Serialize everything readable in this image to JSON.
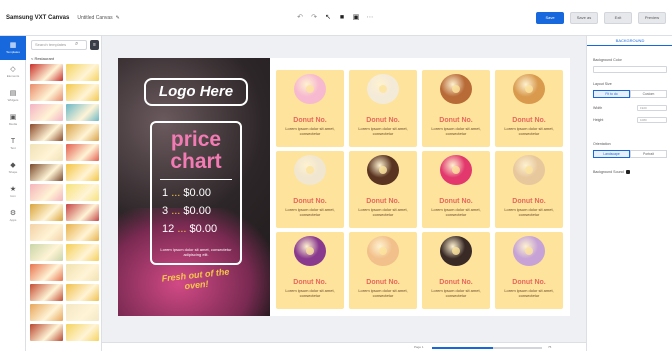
{
  "topbar": {
    "brand": "Samsung VXT Canvas",
    "document_name": "Untitled Canvas",
    "buttons": [
      {
        "label": "Save",
        "primary": true
      },
      {
        "label": "Save as",
        "primary": false
      },
      {
        "label": "Exit",
        "primary": false
      },
      {
        "label": "Preview",
        "primary": false
      }
    ]
  },
  "rail": {
    "items": [
      {
        "label": "Templates",
        "icon": "grid-icon",
        "glyph": "▦",
        "active": true
      },
      {
        "label": "Elements",
        "icon": "shapes-icon",
        "glyph": "◇",
        "active": false
      },
      {
        "label": "Widgets",
        "icon": "widget-icon",
        "glyph": "▤",
        "active": false
      },
      {
        "label": "Media",
        "icon": "media-icon",
        "glyph": "▣",
        "active": false
      },
      {
        "label": "Text",
        "icon": "text-icon",
        "glyph": "T",
        "active": false
      },
      {
        "label": "Shape",
        "icon": "shape-icon",
        "glyph": "◆",
        "active": false
      },
      {
        "label": "Icon",
        "icon": "star-icon",
        "glyph": "★",
        "active": false
      },
      {
        "label": "Apps",
        "icon": "apps-icon",
        "glyph": "⚙",
        "active": false
      }
    ]
  },
  "panel": {
    "search_placeholder": "Search templates",
    "back_label": "< Restaurant"
  },
  "thumb_colors": [
    "#c9302c",
    "#f4d35e",
    "#e88b6b",
    "#f2c94c",
    "#f3b3c4",
    "#6bb8c7",
    "#8a4a2a",
    "#d8a247",
    "#f0e1b6",
    "#e4604f",
    "#7a4a2c",
    "#f4c542",
    "#f4b3ba",
    "#f6e27a",
    "#d8a43b",
    "#c64545",
    "#f3d1a7",
    "#e7b24a",
    "#c9d5a8",
    "#f4cf57",
    "#e8734e",
    "#f2e2b0",
    "#c44d34",
    "#f0c04b",
    "#e7a55a",
    "#f3e7c4",
    "#b8472f",
    "#f4d35e"
  ],
  "artboard": {
    "logo": "Logo Here",
    "price_title_line1": "price",
    "price_title_line2": "chart",
    "prices": [
      {
        "qty": "1",
        "dots": "...",
        "price": "$0.00"
      },
      {
        "qty": "3",
        "dots": "...",
        "price": "$0.00"
      },
      {
        "qty": "12",
        "dots": "...",
        "price": "$0.00"
      }
    ],
    "price_footer": "Lorem ipsum dolor sit amet, consectetur adipiscing elit.",
    "tagline": "Fresh out of the oven!",
    "items": [
      {
        "name": "Donut No.",
        "desc": "Lorem ipsum dolor sit amet, consectetur",
        "color": "#f7b9cf"
      },
      {
        "name": "Donut No.",
        "desc": "Lorem ipsum dolor sit amet, consectetur",
        "color": "#f4ead8"
      },
      {
        "name": "Donut No.",
        "desc": "Lorem ipsum dolor sit amet, consectetur",
        "color": "#b86a37"
      },
      {
        "name": "Donut No.",
        "desc": "Lorem ipsum dolor sit amet, consectetur",
        "color": "#d99a4e"
      },
      {
        "name": "Donut No.",
        "desc": "Lorem ipsum dolor sit amet, consectetur",
        "color": "#f1e6cf"
      },
      {
        "name": "Donut No.",
        "desc": "Lorem ipsum dolor sit amet, consectetur",
        "color": "#5a3420"
      },
      {
        "name": "Donut No.",
        "desc": "Lorem ipsum dolor sit amet, consectetur",
        "color": "#e2386d"
      },
      {
        "name": "Donut No.",
        "desc": "Lorem ipsum dolor sit amet, consectetur",
        "color": "#e7c79c"
      },
      {
        "name": "Donut No.",
        "desc": "Lorem ipsum dolor sit amet, consectetur",
        "color": "#8a3a8e"
      },
      {
        "name": "Donut No.",
        "desc": "Lorem ipsum dolor sit amet, consectetur",
        "color": "#f2c08a"
      },
      {
        "name": "Donut No.",
        "desc": "Lorem ipsum dolor sit amet, consectetur",
        "color": "#3a2a26"
      },
      {
        "name": "Donut No.",
        "desc": "Lorem ipsum dolor sit amet, consectetur",
        "color": "#c6a2d6"
      }
    ]
  },
  "bottombar": {
    "zoom_label": "Page 1",
    "zoom_value": "75",
    "zoom_fraction": 0.55
  },
  "rpanel": {
    "tab": "BACKGROUND",
    "bg_color_label": "Background Color",
    "layout_label": "Layout Size",
    "layout_options": [
      "Fit to do",
      "Custom"
    ],
    "width_label": "Width",
    "height_label": "Height",
    "width_value": "1920",
    "height_value": "1080",
    "orientation_label": "Orientation",
    "orientation_options": [
      "Landscape",
      "Portrait"
    ],
    "bg_sound_label": "Background Sound"
  }
}
